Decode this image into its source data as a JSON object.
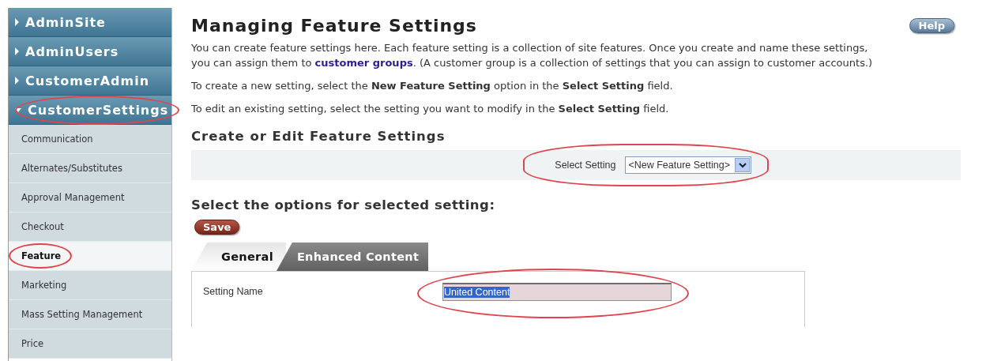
{
  "sidebar": {
    "groups": [
      {
        "label": "AdminSite",
        "expanded": false,
        "circled": false
      },
      {
        "label": "AdminUsers",
        "expanded": false,
        "circled": false
      },
      {
        "label": "CustomerAdmin",
        "expanded": false,
        "circled": false
      },
      {
        "label": "CustomerSettings",
        "expanded": true,
        "circled": true,
        "items": [
          {
            "label": "Communication",
            "selected": false,
            "circled": false
          },
          {
            "label": "Alternates/Substitutes",
            "selected": false,
            "circled": false
          },
          {
            "label": "Approval Management",
            "selected": false,
            "circled": false
          },
          {
            "label": "Checkout",
            "selected": false,
            "circled": false
          },
          {
            "label": "Feature",
            "selected": true,
            "circled": true
          },
          {
            "label": "Marketing",
            "selected": false,
            "circled": false
          },
          {
            "label": "Mass Setting Management",
            "selected": false,
            "circled": false
          },
          {
            "label": "Price",
            "selected": false,
            "circled": false
          }
        ]
      }
    ]
  },
  "page": {
    "title": "Managing Feature Settings",
    "help_button": "Help",
    "intro": {
      "text": "You can create feature settings here. Each feature setting is a collection of site features. Once you create and name these settings, you can assign them to ",
      "link": "customer groups",
      "text_after": ". (A customer group is a collection of settings that you can assign to customer accounts.)"
    },
    "paragraphs": [
      "To create a new setting, select the **New Feature Setting** option in the **Select Setting** field.",
      "To edit an existing setting, select the setting you want to modify in the **Select Setting** field."
    ],
    "section_title": "Create or Edit Feature Settings",
    "select_setting": {
      "label": "Select Setting",
      "value": "<New Feature Setting>",
      "circled": true
    },
    "options_title": "Select the options for selected setting:",
    "save_button": "Save",
    "tabs": [
      {
        "label": "General",
        "selected": true
      },
      {
        "label": "Enhanced Content",
        "selected": false
      }
    ],
    "fields": [
      {
        "label": "Setting Name",
        "value": "United Content",
        "text_selected": true,
        "circled": true
      }
    ]
  }
}
